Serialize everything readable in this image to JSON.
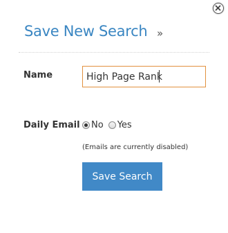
{
  "dialog": {
    "title": "Save New Search",
    "title_chevron": "»",
    "close_icon": "close-icon"
  },
  "form": {
    "name_label": "Name",
    "name_value": "High Page Rank",
    "daily_email_label": "Daily Email",
    "daily_email_options": [
      {
        "label": "No",
        "checked": true
      },
      {
        "label": "Yes",
        "checked": false
      }
    ],
    "email_note": "(Emails are currently disabled)"
  },
  "actions": {
    "save_label": "Save Search"
  },
  "colors": {
    "accent": "#3a86c2",
    "button": "#4189c7",
    "input_focus_border": "#e2913e"
  }
}
